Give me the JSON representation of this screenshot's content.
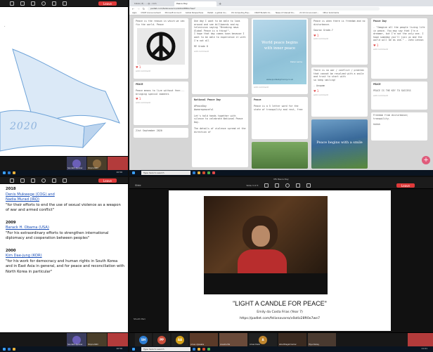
{
  "zoom": {
    "leave_label": "Leave",
    "toolbar_icons": [
      "apps-icon",
      "share-screen-icon",
      "whiteboard-icon",
      "fit-icon",
      "clock-icon",
      "more-icon"
    ],
    "controls": [
      "camera-icon",
      "mic-icon",
      "share-icon"
    ]
  },
  "quad_tl": {
    "banner_year": "2020",
    "participant_name": "Saurabh Ajankar",
    "participant_name2": "Shipra Patil",
    "clock_time": "10:56",
    "clock_date": "04-09-2020",
    "colors": {
      "bg": "#ffffff",
      "banner_stroke": "#6ea3d8",
      "banner_fill": "#dbe9f7"
    }
  },
  "browser": {
    "tabs": [
      {
        "label": "Inbox (3) - ...@...com",
        "active": false
      },
      {
        "label": "Peace Day",
        "active": true
      }
    ],
    "url": "padlet.com/felixnavarro/v0otlz28ft0o7we7",
    "bookmarks": [
      "Apps",
      "CISCE Announcement",
      "Microsoft Account",
      "Global Perspectives",
      "Padlet - a global cla...",
      "DS Computing Exp...",
      "CISCE Bulletin Sl...",
      "News of Interest Do...",
      "21 Oct Announcem...",
      "Other bookmarks"
    ]
  },
  "padlet": {
    "col1": [
      {
        "title": "",
        "body": "Peace is the reason in which we can fix the world. Peace",
        "likes": "1",
        "comments": "add comment",
        "has_image": true
      },
      {
        "title": "PEACE",
        "body": "Peace means to live without fear...\nbringing special moments",
        "likes": "1",
        "comments": "add comment"
      },
      {
        "title": "",
        "body": "21st September 2020",
        "likes": "",
        "comments": ""
      }
    ],
    "col2": [
      {
        "title": "",
        "body": "One day I want to be able to look around and see billboards and my television saying \"Breaking news Global Peace is a thing!\".\nI hope that day comes soon because I want to be able to experience it with I'm not all",
        "footer": "RE Grade 8",
        "likes": "",
        "comments": "add comment"
      },
      {
        "title": "National Peace Day",
        "body": "#PeaceDay\n#wearepeaceful\n\nLet's hold hands together with silence to celebrate National Peace Day.\n\nThe details of violence spread at the direction of",
        "likes": "",
        "comments": ""
      }
    ],
    "col3": [
      {
        "title": "",
        "quote": "World peace begins with inner peace",
        "author": "Dalai Lama",
        "source": "www.quotesbymanny.co.uk",
        "comments": "add comment"
      },
      {
        "title": "Peace",
        "body": "Peace is a 5 letter word for the state of tranquility and rest, free",
        "comments": ""
      }
    ],
    "col4": [
      {
        "title": "",
        "body": "Peace is when there is freedom and no disturbance.",
        "footer": "Saurav Grade-7",
        "likes": "1",
        "comments": "add comment"
      },
      {
        "title": "",
        "body": "There is no war / conflict / problem that cannot be resolved with a smile and trust to start with\nso keep smiling!",
        "footer": "- Anupam",
        "likes": "1",
        "comments": "add comment"
      },
      {
        "title": "",
        "caption": "Peace begins with a smile",
        "comments": ""
      }
    ],
    "col5": [
      {
        "title": "Peace Day",
        "body": "- \"Imagine all the people living life in peace. You may say that I'm a dreamer, but I'm not the only one. I hope someday you'll join us and the world will be as one.\" - John Lennon",
        "likes": "1",
        "comments": "add comment"
      },
      {
        "title": "PEACE",
        "body": "PEACE IS THE KEY TO SUCCESS",
        "likes": "",
        "comments": "add comment"
      },
      {
        "title": "",
        "body": "Freedom from disturbance; tranquility.",
        "footer": "hkhkh",
        "comments": ""
      }
    ]
  },
  "quad_bl": {
    "entries": [
      {
        "year": "2018",
        "names": "Denis Mukwege (COG) and",
        "names2": "Nadia Murad (IRQ)",
        "text": "\"for their efforts to end the use of sexual violence as a weapon of war and armed conflict\""
      },
      {
        "year": "2009",
        "names": "Barack H. Obama (USA)",
        "names2": "",
        "text": "\"For his extraordinary efforts to strengthen international diplomacy and cooperation between peoples\""
      },
      {
        "year": "2000",
        "names": "Kim Dae-jung (KOR)",
        "names2": "",
        "text": "\"for his work for democracy and human rights in South Korea and in East Asia in general, and for peace and reconciliation with North Korea in particular\""
      }
    ],
    "participant_name": "Saurabh Ajankar",
    "participant_name2": "Shipra Patil",
    "clock_time": "10:56",
    "clock_date": "04-09-2020"
  },
  "quad_br": {
    "slide_title": "\"LIGHT A CANDLE FOR PEACE\"",
    "slide_sub": "Emily da Costa Frias (Year 7)",
    "slide_url": "https://padlet.com/felixnavarro/v0otlz28ft0o7we7",
    "presenter_label": "Shuchi Peri",
    "slide_label": "Slide",
    "page_label": "Slide 3 of 3",
    "top_title": "MS Peace Day",
    "participants": [
      {
        "name": "",
        "initials": "SH",
        "color": "#2d7dd2"
      },
      {
        "name": "",
        "initials": "PP",
        "color": "#c94e3b"
      },
      {
        "name": "",
        "initials": "AA",
        "color": "#d4a017"
      },
      {
        "name": "Arnav Ajawaka",
        "initials": "",
        "color": "#5b3a29"
      },
      {
        "name": "Anusha Pal",
        "initials": "",
        "color": "#6a4a3a"
      },
      {
        "name": "Arnav Dalvi",
        "initials": "A",
        "color": "#c0862e"
      },
      {
        "name": "Isha Bhagat Kumar",
        "initials": "",
        "color": "#3a2a20"
      },
      {
        "name": "Hiya Dubey",
        "initials": "",
        "color": "#4a3a30"
      }
    ],
    "clock_time": "11:01",
    "clock_date": "04-09-2020"
  },
  "taskbar": {
    "search_placeholder": "Type here to search"
  },
  "colors": {
    "zoom_bg": "#1b1b1b",
    "leave": "#e03a3a",
    "padlet_bg": "#dcdcdc",
    "taskbar": "#0a1420"
  }
}
